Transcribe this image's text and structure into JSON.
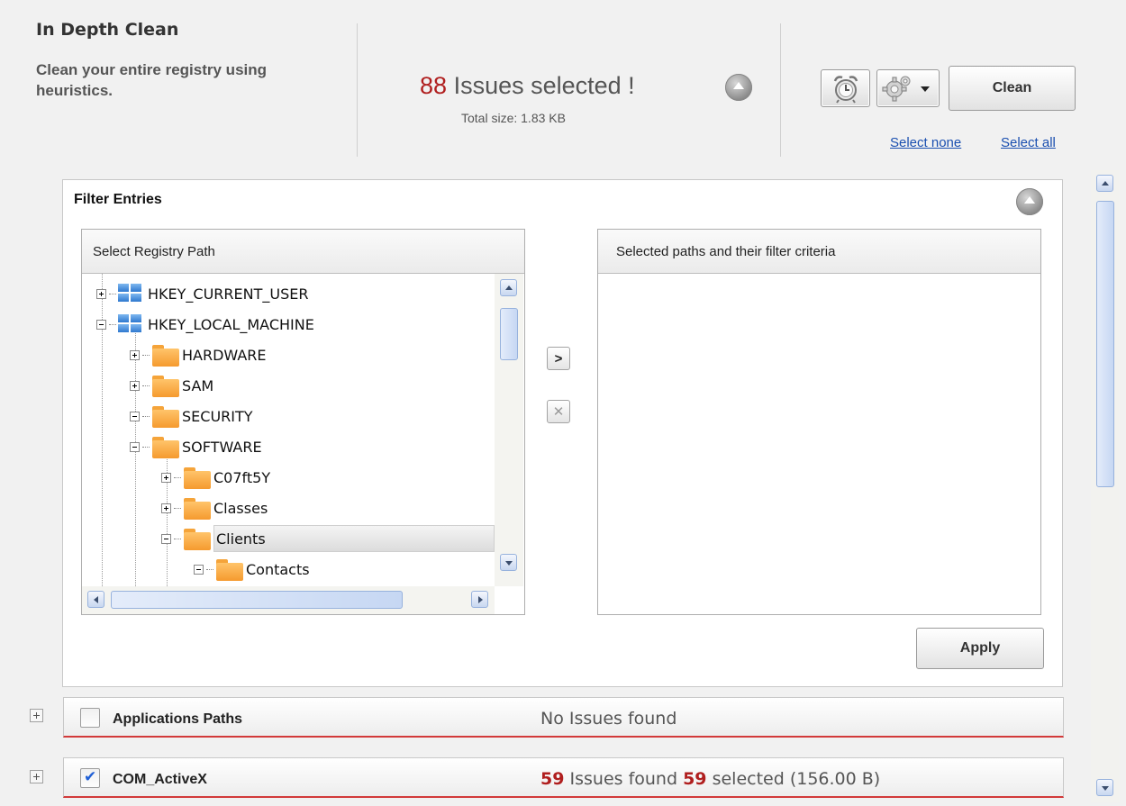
{
  "header": {
    "title": "In Depth Clean",
    "subtitle": "Clean your entire registry using heuristics.",
    "issues_count": "88",
    "issues_text": "Issues selected !",
    "total_size": "Total size: 1.83 KB",
    "clean_label": "Clean",
    "select_none": "Select none",
    "select_all": "Select all",
    "icons": [
      "alarm-clock-icon",
      "gear-icon",
      "chevron-down-icon",
      "collapse-icon"
    ]
  },
  "filter": {
    "title": "Filter Entries",
    "left_header": "Select Registry Path",
    "right_header": "Selected paths and their filter criteria",
    "apply_label": "Apply",
    "add_label": ">",
    "remove_label": "✕",
    "tree": [
      {
        "label": "HKEY_CURRENT_USER",
        "type": "hive",
        "expanded": false
      },
      {
        "label": "HKEY_LOCAL_MACHINE",
        "type": "hive",
        "expanded": true
      },
      {
        "label": "HARDWARE",
        "type": "folder",
        "expanded": false
      },
      {
        "label": "SAM",
        "type": "folder",
        "expanded": false
      },
      {
        "label": "SECURITY",
        "type": "folder",
        "expanded": true
      },
      {
        "label": "SOFTWARE",
        "type": "folder",
        "expanded": true
      },
      {
        "label": "C07ft5Y",
        "type": "folder",
        "expanded": false
      },
      {
        "label": "Classes",
        "type": "folder",
        "expanded": false
      },
      {
        "label": "Clients",
        "type": "folder",
        "expanded": true,
        "selected": true
      },
      {
        "label": "Contacts",
        "type": "folder",
        "expanded": true
      }
    ]
  },
  "categories": [
    {
      "label": "Applications Paths",
      "checked": false,
      "status": "No Issues found"
    },
    {
      "label": "COM_ActiveX",
      "checked": true,
      "found": "59",
      "found_text": "Issues found",
      "selected": "59",
      "selected_text": "selected (156.00 B)"
    }
  ],
  "colors": {
    "accent_red": "#b01e1e",
    "link_blue": "#1a4fb0",
    "folder_orange": "#f59a2e"
  }
}
